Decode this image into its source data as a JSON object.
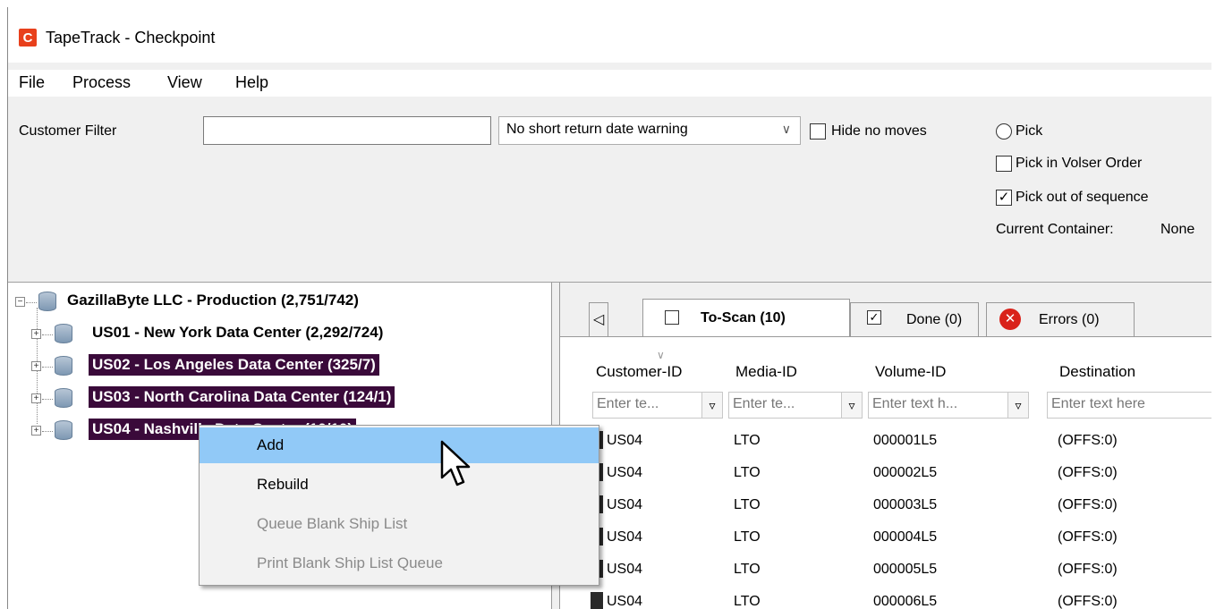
{
  "window": {
    "title": "TapeTrack - Checkpoint",
    "app_icon_letter": "C"
  },
  "menu": [
    "File",
    "Process",
    "View",
    "Help"
  ],
  "toolbar": {
    "customer_filter_label": "Customer Filter",
    "customer_filter_value": "",
    "date_warning_select": "No short return date warning",
    "hide_no_moves": {
      "label": "Hide no moves",
      "checked": false
    },
    "pick": {
      "label": "Pick",
      "selected": false
    },
    "pick_in_volser_order": {
      "label": "Pick in Volser Order",
      "checked": false
    },
    "pick_out_of_sequence": {
      "label": "Pick out of sequence",
      "checked": true
    },
    "current_container_label": "Current Container:",
    "current_container_value": "None"
  },
  "tree": {
    "root": "GazillaByte LLC - Production (2,751/742)",
    "children": [
      {
        "label": "US01 - New York Data Center (2,292/724)",
        "selected": false
      },
      {
        "label": "US02 - Los Angeles Data Center (325/7)",
        "selected": true
      },
      {
        "label": "US03 - North Carolina Data Center (124/1)",
        "selected": true
      },
      {
        "label": "US04 - Nashville Data Center (10/10)",
        "selected": true
      }
    ]
  },
  "context_menu": {
    "items": [
      {
        "label": "Add",
        "enabled": true,
        "hover": true
      },
      {
        "label": "Rebuild",
        "enabled": true,
        "hover": false
      },
      {
        "label": "Queue Blank Ship List",
        "enabled": false,
        "hover": false
      },
      {
        "label": "Print Blank Ship List Queue",
        "enabled": false,
        "hover": false
      }
    ]
  },
  "tabs": {
    "nav_icon": "triangle-left",
    "items": [
      {
        "label": "To-Scan (10)",
        "icon": "checkbox-empty",
        "active": true
      },
      {
        "label": "Done (0)",
        "icon": "checkbox-checked",
        "active": false
      },
      {
        "label": "Errors (0)",
        "icon": "error-circle",
        "active": false
      }
    ]
  },
  "grid": {
    "columns": [
      "Customer-ID",
      "Media-ID",
      "Volume-ID",
      "Destination"
    ],
    "filter_placeholders": [
      "Enter te...",
      "Enter te...",
      "Enter text h...",
      "Enter text here"
    ],
    "rows": [
      [
        "US04",
        "LTO",
        "000001L5",
        "(OFFS:0)"
      ],
      [
        "US04",
        "LTO",
        "000002L5",
        "(OFFS:0)"
      ],
      [
        "US04",
        "LTO",
        "000003L5",
        "(OFFS:0)"
      ],
      [
        "US04",
        "LTO",
        "000004L5",
        "(OFFS:0)"
      ],
      [
        "US04",
        "LTO",
        "000005L5",
        "(OFFS:0)"
      ],
      [
        "US04",
        "LTO",
        "000006L5",
        "(OFFS:0)"
      ]
    ]
  },
  "colors": {
    "selection": "#3a0a3a",
    "menu_hover": "#91c9f7",
    "app_icon": "#e8401c",
    "error_icon": "#d9221a"
  }
}
